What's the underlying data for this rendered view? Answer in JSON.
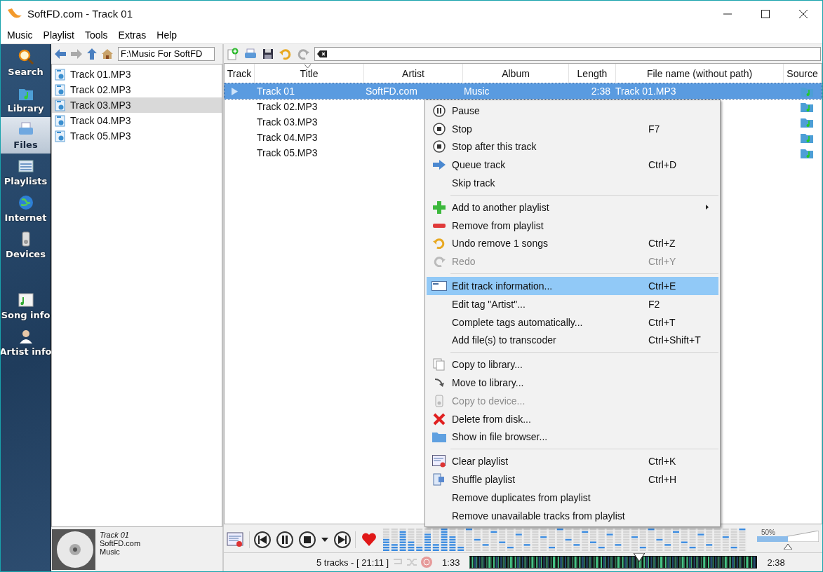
{
  "window": {
    "title": "SoftFD.com - Track 01"
  },
  "menu": [
    "Music",
    "Playlist",
    "Tools",
    "Extras",
    "Help"
  ],
  "sidebar": {
    "items": [
      {
        "label": "Search",
        "selected": false
      },
      {
        "label": "Library",
        "selected": false
      },
      {
        "label": "Files",
        "selected": true
      },
      {
        "label": "Playlists",
        "selected": false
      },
      {
        "label": "Internet",
        "selected": false
      },
      {
        "label": "Devices",
        "selected": false
      },
      {
        "label": "Song info",
        "selected": false
      },
      {
        "label": "Artist info",
        "selected": false
      }
    ]
  },
  "file_browser": {
    "path": "F:\\Music For SoftFD",
    "files": [
      {
        "name": "Track 01.MP3",
        "selected": false
      },
      {
        "name": "Track 02.MP3",
        "selected": false
      },
      {
        "name": "Track 03.MP3",
        "selected": true
      },
      {
        "name": "Track 04.MP3",
        "selected": false
      },
      {
        "name": "Track 05.MP3",
        "selected": false
      }
    ]
  },
  "playlist": {
    "columns": [
      "Track",
      "Title",
      "Artist",
      "Album",
      "Length",
      "File name (without path)",
      "Source"
    ],
    "rows": [
      {
        "title": "Track 01",
        "artist": "SoftFD.com",
        "album": "Music",
        "length": "2:38",
        "file_name": "Track 01.MP3",
        "selected": true,
        "playing": true
      },
      {
        "title": "Track 02.MP3",
        "selected": false,
        "playing": false
      },
      {
        "title": "Track 03.MP3",
        "selected": false,
        "playing": false
      },
      {
        "title": "Track 04.MP3",
        "selected": false,
        "playing": false
      },
      {
        "title": "Track 05.MP3",
        "selected": false,
        "playing": false
      }
    ]
  },
  "context_menu": [
    {
      "kind": "item",
      "label": "Pause",
      "disabled": false,
      "highlighted": false
    },
    {
      "kind": "item",
      "label": "Stop",
      "shortcut": "F7",
      "disabled": false,
      "highlighted": false
    },
    {
      "kind": "item",
      "label": "Stop after this track",
      "disabled": false,
      "highlighted": false
    },
    {
      "kind": "item",
      "label": "Queue track",
      "shortcut": "Ctrl+D",
      "disabled": false,
      "highlighted": false
    },
    {
      "kind": "item",
      "label": "Skip track",
      "disabled": false,
      "highlighted": false
    },
    {
      "kind": "separator"
    },
    {
      "kind": "item",
      "label": "Add to another playlist",
      "submenu": true,
      "disabled": false,
      "highlighted": false
    },
    {
      "kind": "item",
      "label": "Remove from playlist",
      "disabled": false,
      "highlighted": false
    },
    {
      "kind": "item",
      "label": "Undo remove 1 songs",
      "shortcut": "Ctrl+Z",
      "disabled": false,
      "highlighted": false
    },
    {
      "kind": "item",
      "label": "Redo",
      "shortcut": "Ctrl+Y",
      "disabled": true,
      "highlighted": false
    },
    {
      "kind": "separator"
    },
    {
      "kind": "item",
      "label": "Edit track information...",
      "shortcut": "Ctrl+E",
      "disabled": false,
      "highlighted": true
    },
    {
      "kind": "item",
      "label": "Edit tag \"Artist\"...",
      "shortcut": "F2",
      "disabled": false,
      "highlighted": false
    },
    {
      "kind": "item",
      "label": "Complete tags automatically...",
      "shortcut": "Ctrl+T",
      "disabled": false,
      "highlighted": false
    },
    {
      "kind": "item",
      "label": "Add file(s) to transcoder",
      "shortcut": "Ctrl+Shift+T",
      "disabled": false,
      "highlighted": false
    },
    {
      "kind": "separator"
    },
    {
      "kind": "item",
      "label": "Copy to library...",
      "disabled": false,
      "highlighted": false
    },
    {
      "kind": "item",
      "label": "Move to library...",
      "disabled": false,
      "highlighted": false
    },
    {
      "kind": "item",
      "label": "Copy to device...",
      "disabled": true,
      "highlighted": false
    },
    {
      "kind": "item",
      "label": "Delete from disk...",
      "disabled": false,
      "highlighted": false
    },
    {
      "kind": "item",
      "label": "Show in file browser...",
      "disabled": false,
      "highlighted": false
    },
    {
      "kind": "separator"
    },
    {
      "kind": "item",
      "label": "Clear playlist",
      "shortcut": "Ctrl+K",
      "disabled": false,
      "highlighted": false
    },
    {
      "kind": "item",
      "label": "Shuffle playlist",
      "shortcut": "Ctrl+H",
      "disabled": false,
      "highlighted": false
    },
    {
      "kind": "item",
      "label": "Remove duplicates from playlist",
      "disabled": false,
      "highlighted": false
    },
    {
      "kind": "item",
      "label": "Remove unavailable tracks from playlist",
      "disabled": false,
      "highlighted": false
    }
  ],
  "now_playing": {
    "title": "Track 01",
    "artist": "SoftFD.com",
    "album": "Music"
  },
  "status_bar": {
    "summary": "5 tracks - [ 21:11 ]",
    "elapsed": "1:33",
    "total": "2:38",
    "position": {
      "level": 0.59
    }
  },
  "volume": {
    "reading": "50%",
    "level": 0.5
  }
}
